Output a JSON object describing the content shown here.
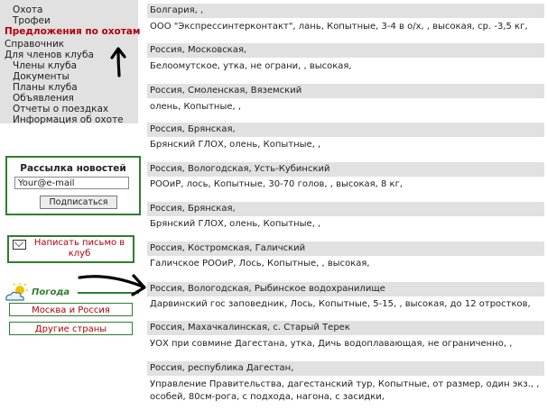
{
  "menu": {
    "items": [
      {
        "label": "Охота",
        "active": false
      },
      {
        "label": "Трофеи",
        "active": false
      },
      {
        "label": "Предложения по охотам",
        "active": true
      },
      {
        "label": "Справочник",
        "active": false
      },
      {
        "label": "Для членов клуба",
        "active": false
      },
      {
        "label": "Члены клуба",
        "active": false
      },
      {
        "label": "Документы",
        "active": false
      },
      {
        "label": "Планы клуба",
        "active": false
      },
      {
        "label": "Объявления",
        "active": false
      },
      {
        "label": "Отчеты о поездках",
        "active": false
      },
      {
        "label": "Информация об охоте",
        "active": false
      }
    ]
  },
  "newsletter": {
    "title": "Рассылка новостей",
    "email_value": "Your@e-mail",
    "subscribe_label": "Подписаться"
  },
  "mail": {
    "label": "Написать письмо в клуб",
    "icon": "envelope-icon"
  },
  "weather": {
    "title": "Погода",
    "icon": "sun-cloud-icon",
    "buttons": [
      "Москва и Россия",
      "Другие страны"
    ]
  },
  "listings": [
    {
      "header": "Болгария, ,",
      "details": [
        "ООО \"Экспрессинтерконтакт\", лань, Копытные, 3-4 в о/х, , высокая, ср. -3,5 кг,"
      ]
    },
    {
      "header": "Россия, Московская,",
      "details": [
        "Белоомутское, утка, не ограни, , высокая,"
      ]
    },
    {
      "header": "Россия, Смоленская, Вяземский",
      "details": [
        "олень, Копытные, ,"
      ]
    },
    {
      "header": "Россия, Брянская,",
      "details": [
        "Брянский ГЛОХ, олень, Копытные, ,"
      ]
    },
    {
      "header": "Россия, Вологодская, Усть-Кубинский",
      "details": [
        "РООиР, лось, Копытные, 30-70 голов, , высокая, 8 кг,"
      ]
    },
    {
      "header": "Россия, Брянская,",
      "details": [
        "Брянский ГЛОХ, олень, Копытные, ,"
      ]
    },
    {
      "header": "Россия, Костромская, Галичский",
      "details": [
        "Галичское РООиР, Лось, Копытные, , высокая,"
      ]
    },
    {
      "header": "Россия, Вологодская, Рыбинское водохранилище",
      "details": [
        "Дарвинский гос заповедник, Лось, Копытные, 5-15, , высокая, до 12 отростков,"
      ]
    },
    {
      "header": "Россия, Махачкалинская, с. Старый Терек",
      "details": [
        "УОХ при совмине Дагестана, утка, Дичь водоплавающая, не ограниченно, ,"
      ]
    },
    {
      "header": "Россия, республика Дагестан,",
      "details": [
        "Управление Правительства, дагестанский тур, Копытные, от размер, один экз., ,",
        "особей, 80см-рога, с подхода, нагона, с засидки,"
      ]
    }
  ],
  "annotations": {
    "arrow_color": "#000000"
  }
}
